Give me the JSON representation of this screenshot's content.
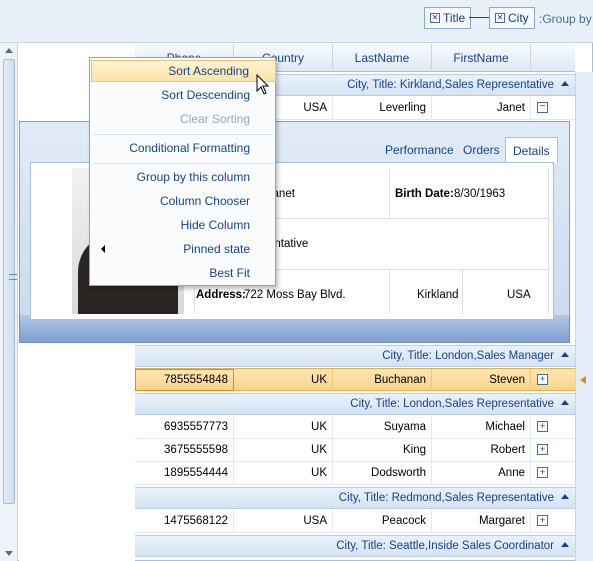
{
  "group_panel": {
    "chips": [
      {
        "label": "Title"
      },
      {
        "label": "City"
      }
    ],
    "label": ":Group by"
  },
  "columns": [
    "Phone",
    "Country",
    "LastName",
    "FirstName"
  ],
  "groups": [
    {
      "label": "City, Title: Kirkland,Sales Representative"
    },
    {
      "label": "City, Title: London,Sales Manager"
    },
    {
      "label": "City, Title: London,Sales Representative"
    },
    {
      "label": "City, Title: Redmond,Sales Representative"
    },
    {
      "label": "City, Title: Seattle,Inside Sales Coordinator"
    }
  ],
  "rows": [
    {
      "phone": "",
      "country": "USA",
      "last": "Leverling",
      "first": "Janet"
    },
    {
      "phone": "7855554848",
      "country": "UK",
      "last": "Buchanan",
      "first": "Steven"
    },
    {
      "phone": "6935557773",
      "country": "UK",
      "last": "Suyama",
      "first": "Michael"
    },
    {
      "phone": "3675555598",
      "country": "UK",
      "last": "King",
      "first": "Robert"
    },
    {
      "phone": "1895554444",
      "country": "UK",
      "last": "Dodsworth",
      "first": "Anne"
    },
    {
      "phone": "1475568122",
      "country": "USA",
      "last": "Peacock",
      "first": "Margaret"
    }
  ],
  "details": {
    "tabs": [
      "Performance",
      "Orders",
      "Details"
    ],
    "name_partial": "g, Janet",
    "birth_label": "Birth Date:",
    "birth_value": "8/30/1963",
    "title_partial": "resentative",
    "address_label": "Address:",
    "address_value": "722 Moss Bay Blvd.",
    "city": "Kirkland",
    "country": "USA"
  },
  "context_menu": {
    "items": [
      "Sort Ascending",
      "Sort Descending",
      "Clear Sorting",
      "Conditional Formatting",
      "Group by this column",
      "Column Chooser",
      "Hide Column",
      "Pinned state",
      "Best Fit"
    ]
  },
  "colors": {
    "accent": "#15428b",
    "selection": "#fbd38a",
    "menu_hot": "#fde3a3"
  }
}
